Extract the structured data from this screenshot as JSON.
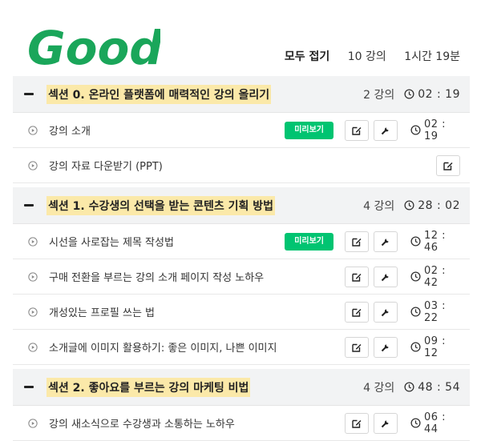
{
  "overlay": {
    "good_text": "Good!"
  },
  "summary": {
    "collapse_all": "모두 접기",
    "total_lectures": "10 강의",
    "total_time": "1시간 19분"
  },
  "sections": [
    {
      "title": "섹션 0. 온라인 플랫폼에 매력적인 강의 올리기",
      "count": "2 강의",
      "time": "02 : 19",
      "lessons": [
        {
          "title": "강의 소개",
          "preview": "미리보기",
          "time": "02 : 19"
        },
        {
          "title": "강의 자료 다운받기 (PPT)"
        }
      ]
    },
    {
      "title": "섹션 1. 수강생의 선택을 받는 콘텐츠 기획 방법",
      "count": "4 강의",
      "time": "28 : 02",
      "lessons": [
        {
          "title": "시선을 사로잡는 제목 작성법",
          "preview": "미리보기",
          "time": "12 : 46"
        },
        {
          "title": "구매 전환을 부르는 강의 소개 페이지 작성 노하우",
          "time": "02 : 42"
        },
        {
          "title": "개성있는 프로필 쓰는 법",
          "time": "03 : 22"
        },
        {
          "title": "소개글에 이미지 활용하기: 좋은 이미지, 나쁜 이미지",
          "time": "09 : 12"
        }
      ]
    },
    {
      "title": "섹션 2. 좋아요를 부르는 강의 마케팅 비법",
      "count": "4 강의",
      "time": "48 : 54",
      "lessons": [
        {
          "title": "강의 새소식으로 수강생과 소통하는 노하우",
          "time": "06 : 44"
        }
      ]
    }
  ],
  "colors": {
    "accent_green": "#00c471",
    "highlight_yellow": "#fbe9a9",
    "good_green": "#1aa65a"
  },
  "icons": {
    "minus": "minus-icon",
    "play": "play-circle-icon",
    "edit": "edit-icon",
    "wrench": "wrench-icon",
    "clock": "clock-icon"
  }
}
